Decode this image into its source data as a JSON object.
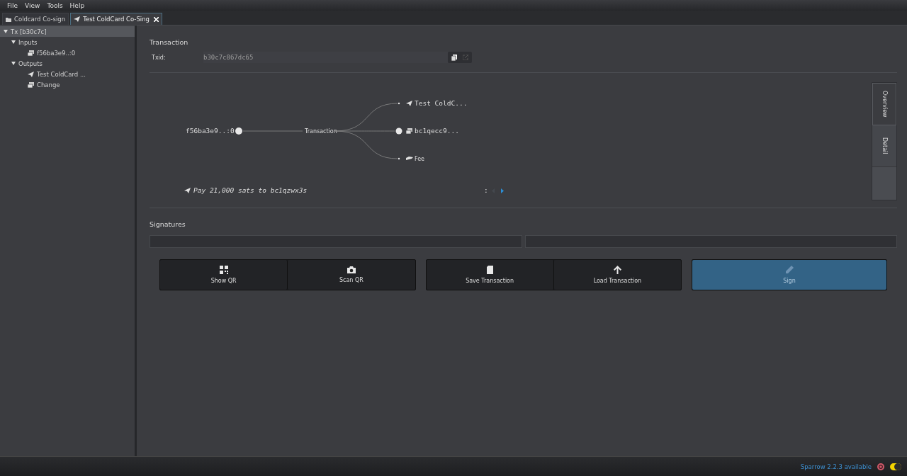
{
  "menu": [
    "File",
    "View",
    "Tools",
    "Help"
  ],
  "tabs": [
    {
      "label": "Coldcard Co-sign",
      "kind": "wallet",
      "selected": false,
      "closable": false
    },
    {
      "label": "Test ColdCard Co-Sing",
      "kind": "send",
      "selected": true,
      "closable": true
    }
  ],
  "tree": [
    {
      "label": "Tx [b30c7c]",
      "expanded": true,
      "selected": true,
      "children": [
        {
          "label": "Inputs",
          "expanded": true,
          "selected": false,
          "children": [
            {
              "label": "f56ba3e9..:0",
              "kind": "utxo",
              "selected": false
            }
          ]
        },
        {
          "label": "Outputs",
          "expanded": true,
          "selected": false,
          "children": [
            {
              "label": "Test ColdCard ...",
              "kind": "send",
              "selected": false
            },
            {
              "label": "Change",
              "kind": "utxo",
              "selected": false
            }
          ]
        }
      ]
    }
  ],
  "transaction": {
    "title": "Transaction",
    "txid_label": "Txid:",
    "txid": "b30c7c867dc65"
  },
  "diagram": {
    "input": "f56ba3e9..:0",
    "center": "Transaction",
    "outputs": [
      {
        "label": "Test ColdC...",
        "kind": "send"
      },
      {
        "label": "bc1qecc9...",
        "kind": "utxo"
      },
      {
        "label": "Fee",
        "kind": "fee"
      }
    ],
    "summary": "Pay 21,000 sats to bc1qzwx3s",
    "pager": ":"
  },
  "side_tabs": [
    {
      "label": "Overview",
      "selected": true
    },
    {
      "label": "Detail",
      "selected": false
    }
  ],
  "signatures": {
    "title": "Signatures"
  },
  "button_groups": [
    [
      {
        "label": "Show QR",
        "kind": "qr",
        "disabled": false
      },
      {
        "label": "Scan QR",
        "kind": "camera",
        "disabled": false
      }
    ],
    [
      {
        "label": "Save Transaction",
        "kind": "sdcard",
        "disabled": false
      },
      {
        "label": "Load Transaction",
        "kind": "upload",
        "disabled": false
      }
    ],
    [
      {
        "label": "Sign",
        "kind": "pen",
        "disabled": true
      }
    ]
  ],
  "status": {
    "update": "Sparrow 2.2.3 available",
    "dark_mode": true
  }
}
